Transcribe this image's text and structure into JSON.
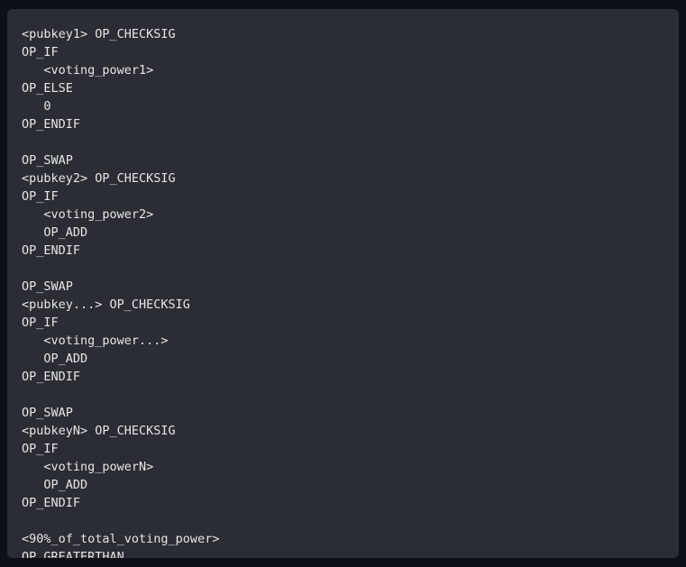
{
  "code": {
    "lines": [
      "<pubkey1> OP_CHECKSIG",
      "OP_IF",
      "   <voting_power1>",
      "OP_ELSE",
      "   0",
      "OP_ENDIF",
      "",
      "OP_SWAP",
      "<pubkey2> OP_CHECKSIG",
      "OP_IF",
      "   <voting_power2>",
      "   OP_ADD",
      "OP_ENDIF",
      "",
      "OP_SWAP",
      "<pubkey...> OP_CHECKSIG",
      "OP_IF",
      "   <voting_power...>",
      "   OP_ADD",
      "OP_ENDIF",
      "",
      "OP_SWAP",
      "<pubkeyN> OP_CHECKSIG",
      "OP_IF",
      "   <voting_powerN>",
      "   OP_ADD",
      "OP_ENDIF",
      "",
      "<90%_of_total_voting_power>",
      "OP_GREATERTHAN"
    ]
  }
}
